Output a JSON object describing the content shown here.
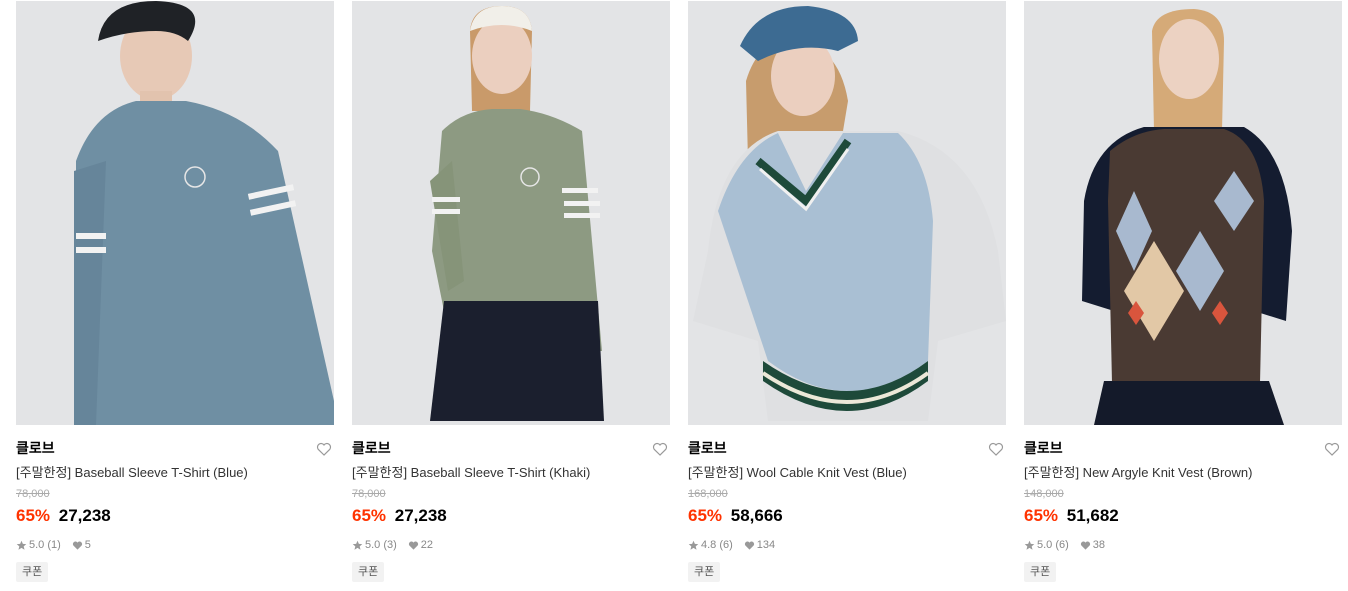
{
  "products": [
    {
      "brand": "클로브",
      "title": "[주말한정] Baseball Sleeve T-Shirt (Blue)",
      "original_price": "78,000",
      "discount": "65%",
      "price": "27,238",
      "rating": "5.0 (1)",
      "likes": "5",
      "badge": "쿠폰",
      "garment_color": "#6f8fa3",
      "garment_type": "tshirt"
    },
    {
      "brand": "클로브",
      "title": "[주말한정] Baseball Sleeve T-Shirt (Khaki)",
      "original_price": "78,000",
      "discount": "65%",
      "price": "27,238",
      "rating": "5.0 (3)",
      "likes": "22",
      "badge": "쿠폰",
      "garment_color": "#8d9a82",
      "garment_type": "tshirt"
    },
    {
      "brand": "클로브",
      "title": "[주말한정] Wool Cable Knit Vest (Blue)",
      "original_price": "168,000",
      "discount": "65%",
      "price": "58,666",
      "rating": "4.8 (6)",
      "likes": "134",
      "badge": "쿠폰",
      "garment_color": "#a9bfd3",
      "garment_type": "vest"
    },
    {
      "brand": "클로브",
      "title": "[주말한정] New Argyle Knit Vest (Brown)",
      "original_price": "148,000",
      "discount": "65%",
      "price": "51,682",
      "rating": "5.0 (6)",
      "likes": "38",
      "badge": "쿠폰",
      "garment_color": "#4a3a33",
      "garment_type": "argyle"
    }
  ],
  "colors": {
    "discount": "#ff3300",
    "muted": "#888888",
    "background": "#e4e5e7"
  }
}
